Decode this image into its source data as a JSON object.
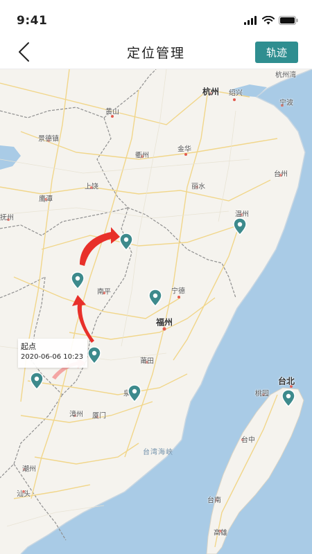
{
  "status_bar": {
    "time": "9:41"
  },
  "nav": {
    "title": "定位管理",
    "track_button": "轨迹"
  },
  "map": {
    "sea_label": "台湾海峡",
    "cities": [
      {
        "name": "杭州",
        "major": true
      },
      {
        "name": "绍兴",
        "major": false
      },
      {
        "name": "宁波",
        "major": false
      },
      {
        "name": "杭州湾",
        "major": false
      },
      {
        "name": "黄山",
        "major": false
      },
      {
        "name": "景德镇",
        "major": false
      },
      {
        "name": "衢州",
        "major": false
      },
      {
        "name": "金华",
        "major": false
      },
      {
        "name": "台州",
        "major": false
      },
      {
        "name": "上饶",
        "major": false
      },
      {
        "name": "鹰潭",
        "major": false
      },
      {
        "name": "丽水",
        "major": false
      },
      {
        "name": "温州",
        "major": false
      },
      {
        "name": "抚州",
        "major": false
      },
      {
        "name": "南平",
        "major": false
      },
      {
        "name": "宁德",
        "major": false
      },
      {
        "name": "福州",
        "major": true
      },
      {
        "name": "莆田",
        "major": false
      },
      {
        "name": "泉州",
        "major": false
      },
      {
        "name": "漳州",
        "major": false
      },
      {
        "name": "厦门",
        "major": false
      },
      {
        "name": "潮州",
        "major": false
      },
      {
        "name": "汕头",
        "major": false
      },
      {
        "name": "台北",
        "major": true
      },
      {
        "name": "桃园",
        "major": false
      },
      {
        "name": "台中",
        "major": false
      },
      {
        "name": "台南",
        "major": false
      },
      {
        "name": "高雄",
        "major": false
      }
    ],
    "start_popup": {
      "title": "起点",
      "time": "2020-06-06 10:23"
    }
  },
  "colors": {
    "accent": "#2f8e90",
    "marker": "#3d8a8c",
    "arrow": "#e8302a",
    "sea": "#a9cbe6"
  }
}
